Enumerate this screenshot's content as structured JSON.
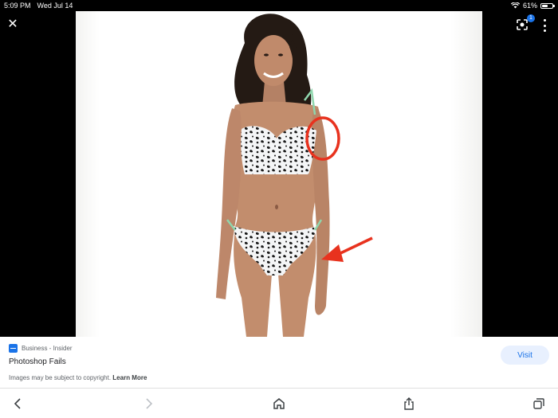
{
  "status_bar": {
    "time": "5:09 PM",
    "date": "Wed Jul 14",
    "battery": "61%",
    "battery_level": 0.61
  },
  "viewer": {
    "lens_badge": "1",
    "icons": {
      "close": "close-icon",
      "lens": "google-lens-icon",
      "more": "more-vert-icon"
    }
  },
  "result": {
    "source": "Business - Insider",
    "title": "Photoshop Fails",
    "visit_label": "Visit",
    "copyright_text": "Images may be subject to copyright.",
    "learn_more": "Learn More"
  },
  "toolbar": {
    "icons": [
      "back-icon",
      "forward-icon",
      "home-icon",
      "share-icon",
      "tabs-icon"
    ]
  },
  "colors": {
    "accent": "#1a73e8",
    "annotation_red": "#e8321e"
  }
}
